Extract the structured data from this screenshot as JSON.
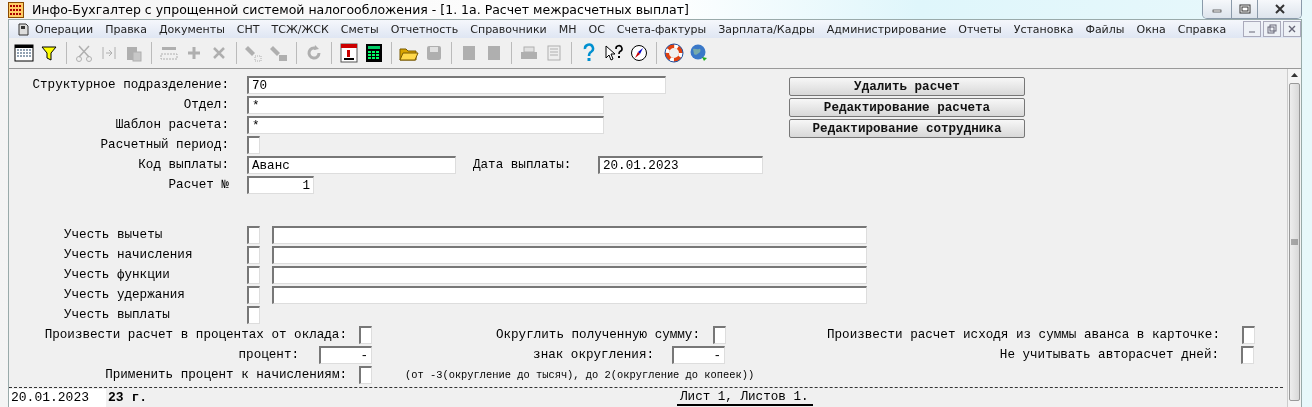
{
  "window": {
    "title": "Инфо-Бухгалтер с упрощенной системой налогообложения - [1. 1а. Расчет межрасчетных выплат]"
  },
  "menu": [
    "Операции",
    "Правка",
    "Документы",
    "СНТ",
    "ТСЖ/ЖСК",
    "Сметы",
    "Отчетность",
    "Справочники",
    "МН",
    "ОС",
    "Счета-фактуры",
    "Зарплата/Кадры",
    "Администрирование",
    "Отчеты",
    "Установка",
    "Файлы",
    "Окна",
    "Справка"
  ],
  "toolbar": [
    {
      "kind": "table",
      "disabled": false
    },
    {
      "kind": "filter",
      "disabled": false
    },
    {
      "kind": "sep"
    },
    {
      "kind": "cut",
      "disabled": true
    },
    {
      "kind": "swap",
      "disabled": true
    },
    {
      "kind": "paste",
      "disabled": true
    },
    {
      "kind": "sep"
    },
    {
      "kind": "rotate",
      "disabled": true
    },
    {
      "kind": "plus",
      "disabled": true
    },
    {
      "kind": "cross",
      "disabled": true
    },
    {
      "kind": "sep"
    },
    {
      "kind": "marker",
      "disabled": true
    },
    {
      "kind": "marker-ab",
      "disabled": true
    },
    {
      "kind": "sep"
    },
    {
      "kind": "refresh",
      "disabled": true
    },
    {
      "kind": "sep"
    },
    {
      "kind": "calendar",
      "disabled": false
    },
    {
      "kind": "calculator",
      "disabled": false
    },
    {
      "kind": "sep"
    },
    {
      "kind": "folder",
      "disabled": false
    },
    {
      "kind": "save",
      "disabled": true
    },
    {
      "kind": "sep"
    },
    {
      "kind": "block",
      "disabled": true
    },
    {
      "kind": "block",
      "disabled": true
    },
    {
      "kind": "sep"
    },
    {
      "kind": "print",
      "disabled": true
    },
    {
      "kind": "sheet",
      "disabled": true
    },
    {
      "kind": "sep"
    },
    {
      "kind": "help",
      "disabled": false
    },
    {
      "kind": "context-help",
      "disabled": false
    },
    {
      "kind": "compass",
      "disabled": false
    },
    {
      "kind": "sep"
    },
    {
      "kind": "lifebuoy",
      "disabled": false
    },
    {
      "kind": "globe",
      "disabled": false
    }
  ],
  "form": {
    "division": {
      "label": "Структурное подразделение:",
      "value": "70"
    },
    "department": {
      "label": "Отдел:",
      "value": "*"
    },
    "template": {
      "label": "Шаблон расчета:",
      "value": "*"
    },
    "period": {
      "label": "Расчетный период:",
      "checked": false
    },
    "payment_code": {
      "label": "Код выплаты:",
      "value": "Аванс"
    },
    "payment_date": {
      "label": "Дата выплаты:",
      "value": "20.01.2023"
    },
    "calc_number": {
      "label": "Расчет №",
      "value": "1"
    },
    "buttons": [
      "Удалить расчет",
      "Редактирование расчета",
      "Редактирование сотрудника"
    ],
    "include": [
      {
        "label": "Учесть вычеты",
        "checked": false,
        "has_field": true
      },
      {
        "label": "Учесть начисления",
        "checked": false,
        "has_field": true
      },
      {
        "label": "Учесть функции",
        "checked": false,
        "has_field": true
      },
      {
        "label": "Учесть удержания",
        "checked": false,
        "has_field": true
      },
      {
        "label": "Учесть выплаты",
        "checked": false,
        "has_field": false
      }
    ],
    "percent_of_salary": {
      "label": "Произвести расчет в процентах от оклада:",
      "checked": false
    },
    "round_sum": {
      "label": "Округлить полученную сумму:",
      "checked": false
    },
    "from_advance": {
      "label": "Произвести расчет исходя из суммы аванса в карточке:",
      "checked": false
    },
    "percent": {
      "label": "процент:",
      "value": "-"
    },
    "round_sign": {
      "label": "знак округления:",
      "value": "-"
    },
    "ignore_days": {
      "label": "Не учитывать авторасчет дней:",
      "checked": false
    },
    "apply_percent": {
      "label": "Применить процент к начислениям:",
      "checked": false
    },
    "round_note": "(от -3(округление до тысяч), до 2(округление до копеек))"
  },
  "status_bar": {
    "date": "20.01.2023",
    "text": "23 г.",
    "pages": "Лист 1, Листов 1."
  }
}
